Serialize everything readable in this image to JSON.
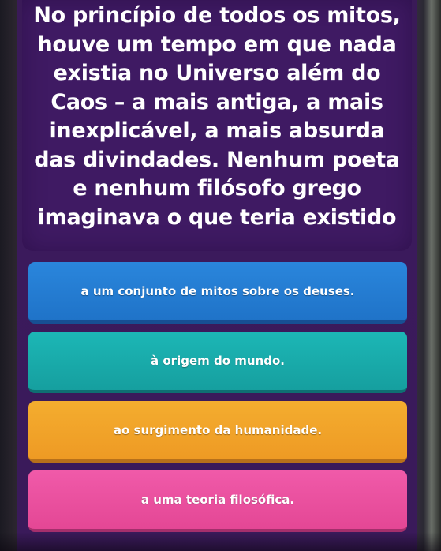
{
  "question": {
    "lines": [
      "No princípio de todos os mitos,",
      "houve um tempo em que nada",
      "existia no Universo além do",
      "Caos – a mais antiga, a mais",
      "inexplicável, a mais absurda",
      "das divindades. Nenhum poeta",
      "e nenhum filósofo grego",
      "imaginava o que teria existido"
    ]
  },
  "answers": [
    {
      "label": "a um conjunto de mitos sobre os deuses.",
      "color": "#2a86dc"
    },
    {
      "label": "à origem do mundo.",
      "color": "#1cb7b6"
    },
    {
      "label": "ao surgimento da humanidade.",
      "color": "#f4ad2f"
    },
    {
      "label": "a uma teoria filosófica.",
      "color": "#f05aa9"
    }
  ]
}
